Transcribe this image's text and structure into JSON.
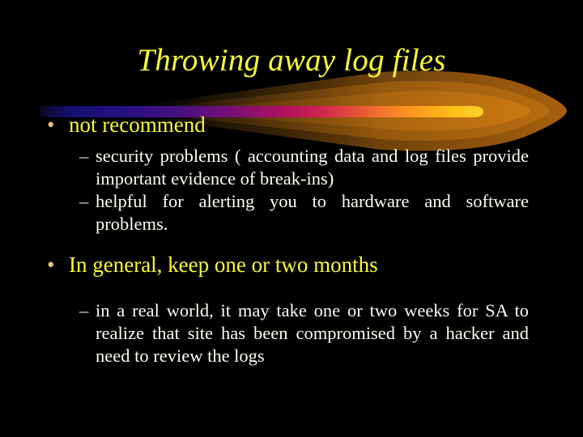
{
  "slide": {
    "title": "Throwing away log files",
    "background_color": "#000000",
    "title_color": "#FAFA32",
    "level1_color": "#FAFA32",
    "level2_color": "#FFFBF2",
    "level1_bullet_color": "#EFBC7B",
    "level1_bullet_glyph": "•",
    "level2_bullet_glyph": "–",
    "decoration": {
      "name": "comet-streak",
      "head_color": "#FFC61A",
      "tail_colors": [
        "#FFD21E",
        "#FF8C1A",
        "#E0344C",
        "#C01070",
        "#5A1080",
        "#1A1070",
        "#0C0830"
      ],
      "glow_color": "#B56A10"
    },
    "bullets": [
      {
        "level": 1,
        "marker": "•",
        "text": "not recommend"
      },
      {
        "level": 2,
        "marker": "–",
        "text": "security problems ( accounting data and log files provide important evidence of break-ins)"
      },
      {
        "level": 2,
        "marker": "–",
        "text": "helpful for alerting you to hardware and software problems."
      },
      {
        "level": 1,
        "marker": "•",
        "text": "In general, keep one or two months"
      },
      {
        "level": 2,
        "marker": "–",
        "text": "in a real world, it may take one or two weeks for SA to realize that site has been compromised by a hacker and need to review the logs"
      }
    ]
  }
}
